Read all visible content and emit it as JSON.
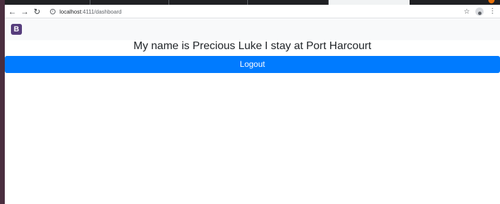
{
  "browser": {
    "url_host": "localhost",
    "url_path": ":4111/dashboard",
    "tabs_count": 5
  },
  "icons": {
    "back": "arrow-left-icon",
    "forward": "arrow-right-icon",
    "reload": "reload-icon",
    "info": "info-icon",
    "star": "star-icon",
    "profile": "profile-icon",
    "menu": "kebab-menu-icon",
    "brand": "bootstrap-logo"
  },
  "navbar": {
    "brand_letter": "B"
  },
  "main": {
    "name_text": "My name is Precious Luke",
    "location_text": "I stay at Port Harcourt",
    "logout_label": "Logout"
  },
  "colors": {
    "primary": "#007bff",
    "brand": "#563d7c",
    "navbar_bg": "#f8f9fa"
  }
}
